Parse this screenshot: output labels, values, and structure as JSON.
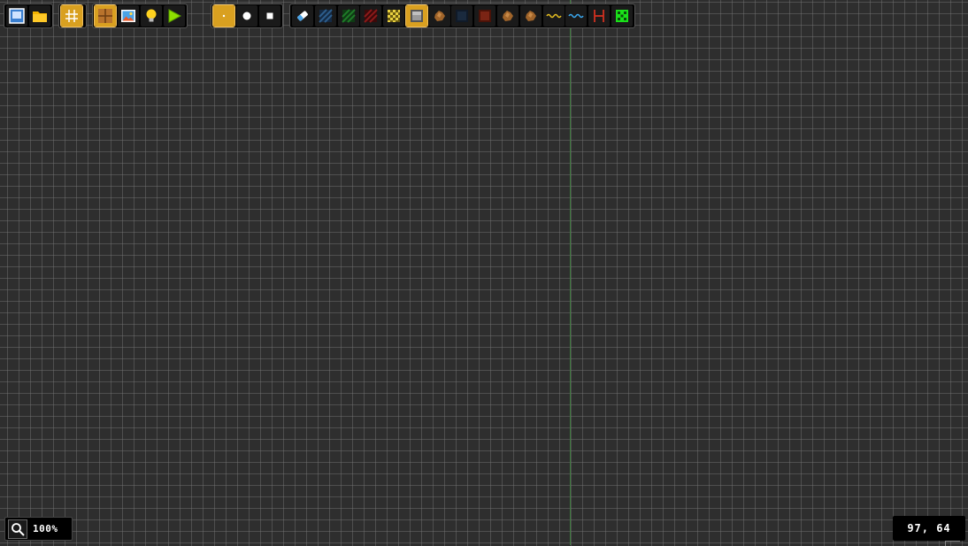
{
  "toolbar": {
    "file_group": [
      {
        "name": "save",
        "icon": "save-icon"
      },
      {
        "name": "open",
        "icon": "folder-icon"
      }
    ],
    "grid_group": [
      {
        "name": "grid-toggle",
        "icon": "grid-icon",
        "active": true
      }
    ],
    "view_group": [
      {
        "name": "tiles",
        "icon": "tiles-icon",
        "active": true
      },
      {
        "name": "background",
        "icon": "image-icon"
      },
      {
        "name": "lights",
        "icon": "lightbulb-icon"
      },
      {
        "name": "play",
        "icon": "play-icon"
      }
    ],
    "brush_group": [
      {
        "name": "brush-point",
        "icon": "point-icon",
        "active": true
      },
      {
        "name": "brush-circle",
        "icon": "circle-icon"
      },
      {
        "name": "brush-square",
        "icon": "square-icon"
      }
    ],
    "tile_group": [
      {
        "name": "eraser",
        "icon": "eraser-icon"
      },
      {
        "name": "tile-blue-hatch",
        "icon": "blue-hatch-icon"
      },
      {
        "name": "tile-green-hatch",
        "icon": "green-hatch-icon"
      },
      {
        "name": "tile-red-hatch",
        "icon": "red-hatch-icon"
      },
      {
        "name": "tile-yellow-checker",
        "icon": "yellow-checker-icon"
      },
      {
        "name": "tile-stone",
        "icon": "stone-block-icon",
        "active": true
      },
      {
        "name": "tile-brown-rock",
        "icon": "brown-rock-icon"
      },
      {
        "name": "tile-dark-blue",
        "icon": "dark-blue-block-icon"
      },
      {
        "name": "tile-red-block",
        "icon": "red-block-icon"
      },
      {
        "name": "tile-brown-rock-2",
        "icon": "brown-rock-icon"
      },
      {
        "name": "tile-brown-rock-3",
        "icon": "brown-rock-icon"
      },
      {
        "name": "tile-yellow-wave",
        "icon": "yellow-wave-icon"
      },
      {
        "name": "tile-blue-wave",
        "icon": "blue-wave-icon"
      },
      {
        "name": "tile-red-ladder",
        "icon": "red-ladder-icon"
      },
      {
        "name": "tile-green-dice",
        "icon": "green-dice-icon"
      }
    ]
  },
  "status": {
    "zoom": "100%",
    "coordinates": "97, 64"
  },
  "colors": {
    "canvas": "#2e2e2e",
    "grid": "#5a5a5a",
    "axis": "#3d7a3d",
    "active": "#d9a020"
  }
}
